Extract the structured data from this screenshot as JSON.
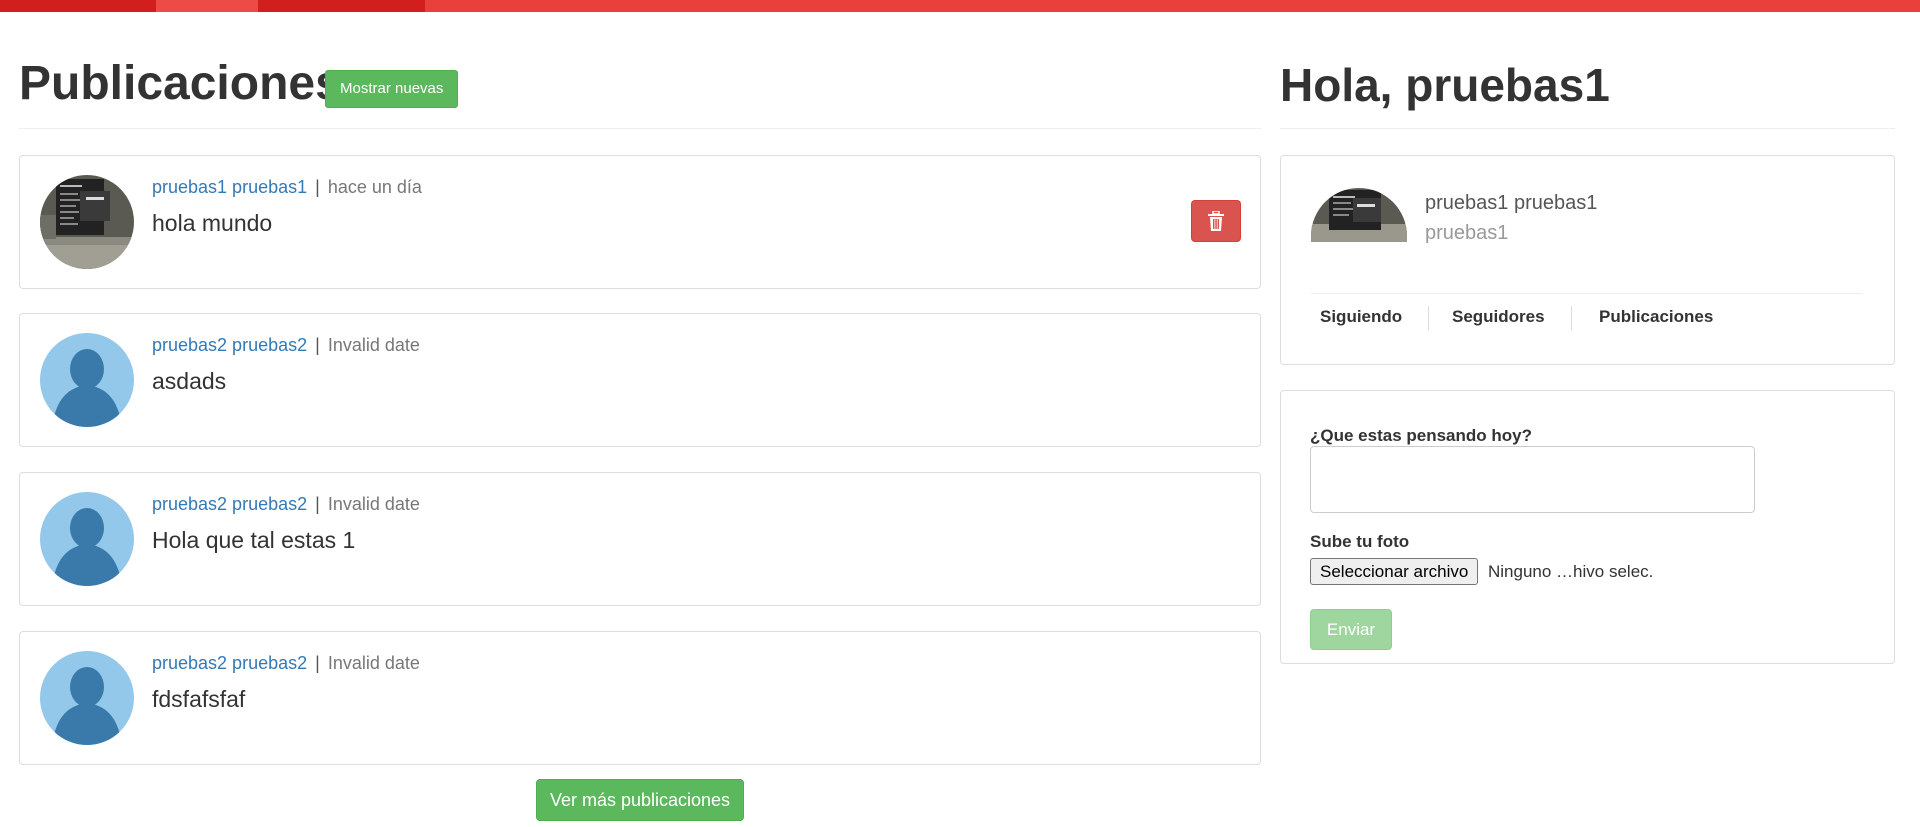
{
  "colors": {
    "topbar": "#e8403a",
    "topbar_dark": "#d01f1c",
    "success": "#5cb85c",
    "success_disabled": "#9fd69f",
    "danger": "#d9534f",
    "link": "#337ab7",
    "muted": "#777777"
  },
  "timeline": {
    "title": "Publicaciones",
    "show_new_label": "Mostrar nuevas",
    "more_label": "Ver más publicaciones",
    "posts": [
      {
        "author": "pruebas1 pruebas1",
        "separator": "|",
        "time": "hace un día",
        "text": "hola mundo",
        "avatar": "screenshot-photo",
        "deletable": true,
        "delete_icon": "trash-icon"
      },
      {
        "author": "pruebas2 pruebas2",
        "separator": "|",
        "time": "Invalid date",
        "text": "asdads",
        "avatar": "default-user-silhouette",
        "deletable": false
      },
      {
        "author": "pruebas2 pruebas2",
        "separator": "|",
        "time": "Invalid date",
        "text": "Hola que tal estas 1",
        "avatar": "default-user-silhouette",
        "deletable": false
      },
      {
        "author": "pruebas2 pruebas2",
        "separator": "|",
        "time": "Invalid date",
        "text": "fdsfafsfaf",
        "avatar": "default-user-silhouette",
        "deletable": false
      }
    ]
  },
  "sidebar": {
    "greeting": "Hola, pruebas1",
    "profile": {
      "name": "pruebas1 pruebas1",
      "nick": "pruebas1",
      "avatar": "screenshot-photo"
    },
    "stats": [
      "Siguiendo",
      "Seguidores",
      "Publicaciones"
    ],
    "form": {
      "text_label": "¿Que estas pensando hoy?",
      "text_value": "",
      "photo_label": "Sube tu foto",
      "file_button": "Seleccionar archivo",
      "file_status": "Ninguno …hivo selec.",
      "submit_label": "Enviar"
    }
  }
}
